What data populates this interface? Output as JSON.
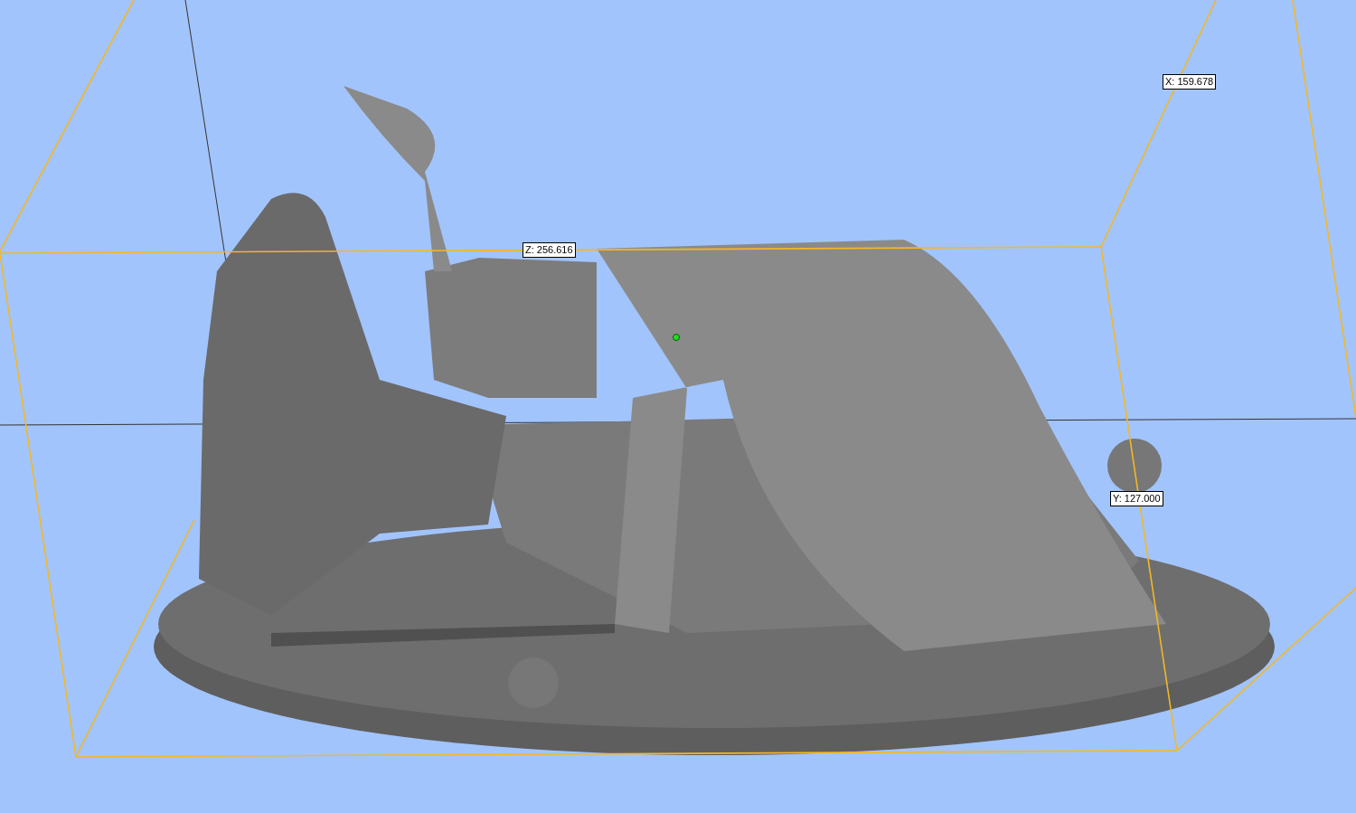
{
  "viewport": {
    "dimension_labels": [
      {
        "text": "X: 159.678"
      },
      {
        "text": "Z: 256.616"
      },
      {
        "text": "Y: 127.000"
      }
    ]
  }
}
